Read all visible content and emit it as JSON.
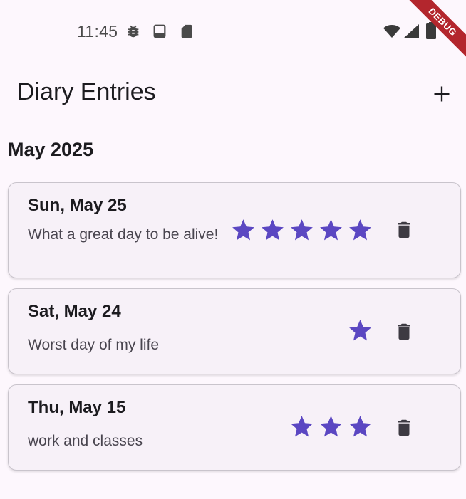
{
  "status_bar": {
    "time": "11:45",
    "icons": [
      "bug-icon",
      "screen-icon",
      "sd-card-icon",
      "wifi-icon",
      "signal-icon",
      "battery-icon"
    ]
  },
  "debug_banner": "DEBUG",
  "app_bar": {
    "title": "Diary Entries",
    "add_icon": "plus-icon"
  },
  "month_header": "May 2025",
  "colors": {
    "accent": "#5b47c2",
    "background": "#fdf7fd",
    "card": "#f7f1f8",
    "debug": "#b3262d"
  },
  "entries": [
    {
      "date": "Sun, May 25",
      "text": "What a great day to be alive!",
      "rating": 5
    },
    {
      "date": "Sat, May 24",
      "text": "Worst day of my life",
      "rating": 1
    },
    {
      "date": "Thu, May 15",
      "text": "work and classes",
      "rating": 3
    }
  ]
}
